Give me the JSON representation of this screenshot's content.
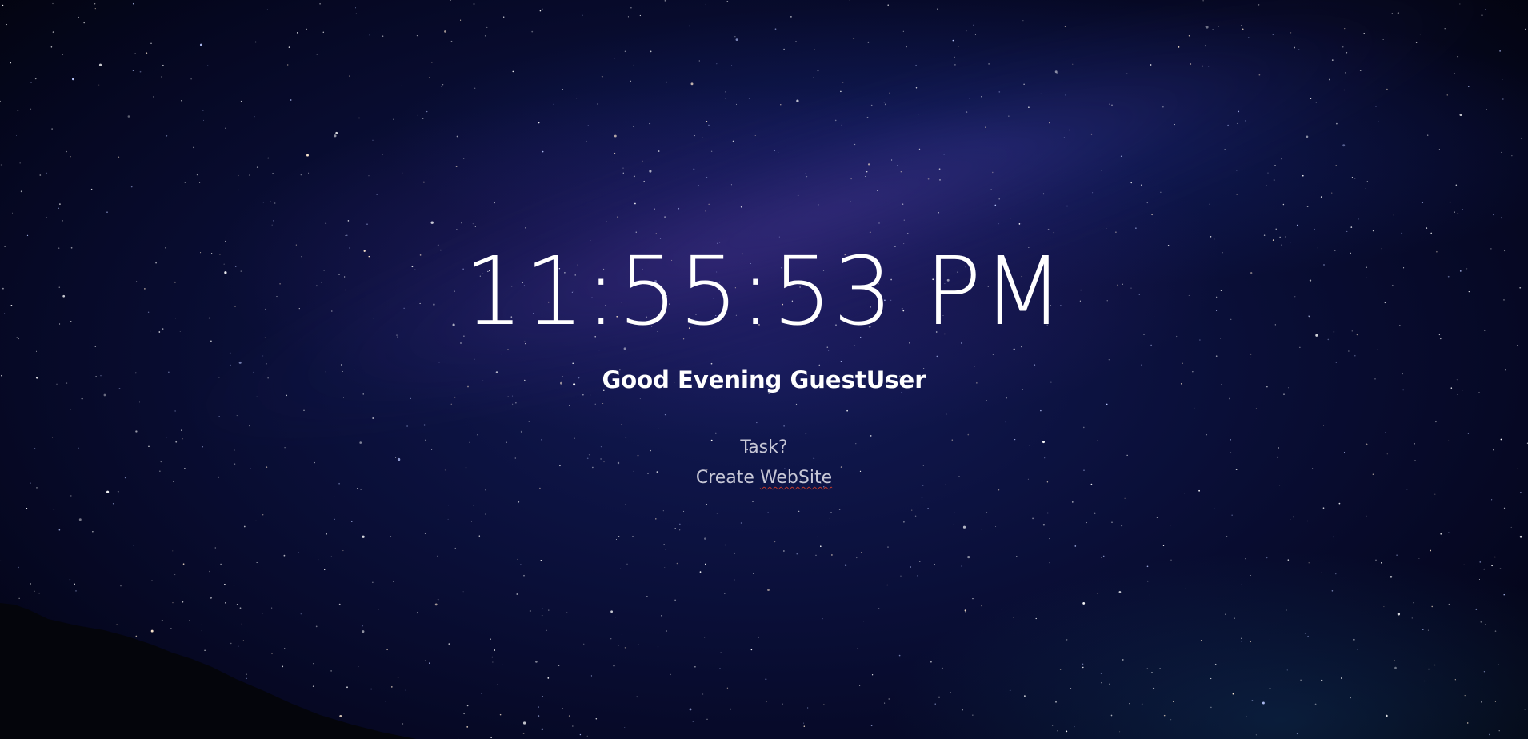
{
  "clock": {
    "time": "11:55:53 PM"
  },
  "greeting": {
    "text": "Good Evening GuestUser"
  },
  "task": {
    "label": "Task?",
    "value_prefix": "Create ",
    "value_flagged_word": "WebSite"
  }
}
